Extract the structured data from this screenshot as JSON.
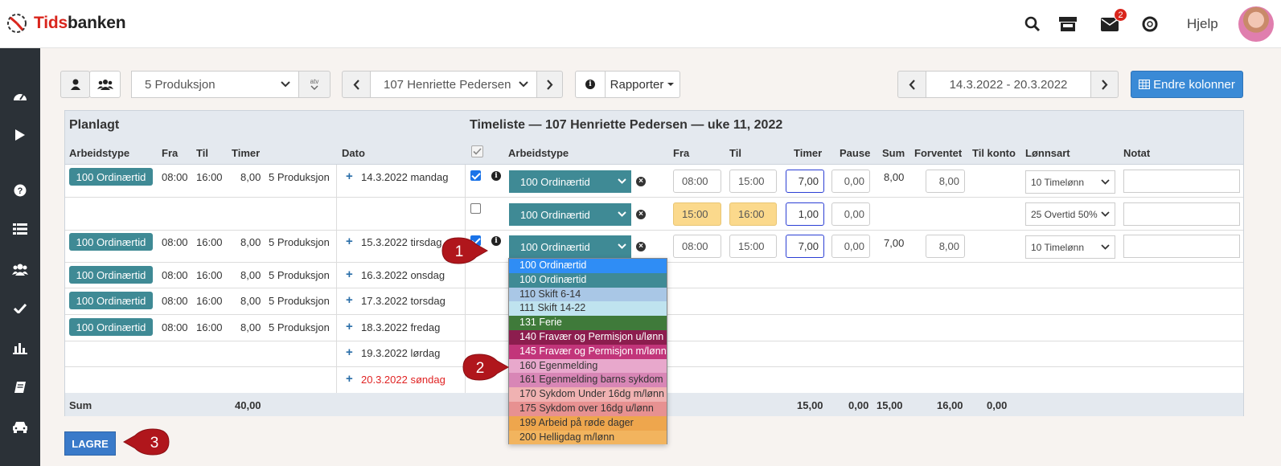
{
  "header": {
    "logo_prefix": "Tids",
    "logo_suffix": "banken",
    "mail_badge": "2",
    "help_label": "Hjelp"
  },
  "toolbar": {
    "department": "5 Produksjon",
    "atv_label": "atv",
    "employee": "107 Henriette Pedersen",
    "reports_label": "Rapporter",
    "date_range": "14.3.2022 - 20.3.2022",
    "change_columns_label": "Endre kolonner"
  },
  "panel": {
    "planned_title": "Planlagt",
    "timesheet_title": "Timeliste — 107 Henriette Pedersen — uke 11, 2022",
    "headers": {
      "arbeidstype": "Arbeidstype",
      "fra": "Fra",
      "til": "Til",
      "timer": "Timer",
      "dato": "Dato",
      "arbeidstype2": "Arbeidstype",
      "fra2": "Fra",
      "til2": "Til",
      "timer2": "Timer",
      "pause": "Pause",
      "sum": "Sum",
      "forventet": "Forventet",
      "til_konto": "Til konto",
      "lonnsart": "Lønnsart",
      "notat": "Notat"
    },
    "planned_rows": [
      {
        "type": "100 Ordinærtid",
        "fra": "08:00",
        "til": "16:00",
        "timer": "8,00",
        "dept": "5 Produksjon"
      },
      {
        "type": "100 Ordinærtid",
        "fra": "08:00",
        "til": "16:00",
        "timer": "8,00",
        "dept": "5 Produksjon"
      },
      {
        "type": "100 Ordinærtid",
        "fra": "08:00",
        "til": "16:00",
        "timer": "8,00",
        "dept": "5 Produksjon"
      },
      {
        "type": "100 Ordinærtid",
        "fra": "08:00",
        "til": "16:00",
        "timer": "8,00",
        "dept": "5 Produksjon"
      },
      {
        "type": "100 Ordinærtid",
        "fra": "08:00",
        "til": "16:00",
        "timer": "8,00",
        "dept": "5 Produksjon"
      }
    ],
    "dates": [
      "14.3.2022 mandag",
      "15.3.2022 tirsdag",
      "16.3.2022 onsdag",
      "17.3.2022 torsdag",
      "18.3.2022 fredag",
      "19.3.2022 lørdag",
      "20.3.2022 søndag"
    ],
    "entries": [
      {
        "type": "100 Ordinærtid",
        "fra": "08:00",
        "til": "15:00",
        "timer": "7,00",
        "pause": "0,00",
        "sum": "8,00",
        "forventet": "8,00",
        "lonnsart": "10 Timelønn"
      },
      {
        "type": "100 Ordinærtid",
        "fra": "15:00",
        "til": "16:00",
        "timer": "1,00",
        "pause": "0,00",
        "lonnsart": "25 Overtid 50%"
      },
      {
        "type": "100 Ordinærtid",
        "fra": "08:00",
        "til": "15:00",
        "timer": "7,00",
        "pause": "0,00",
        "sum": "7,00",
        "forventet": "8,00",
        "lonnsart": "10 Timelønn"
      }
    ],
    "sum_row": {
      "label": "Sum",
      "planned_timer": "40,00",
      "timer": "15,00",
      "pause": "0,00",
      "sum": "15,00",
      "forventet": "16,00",
      "til_konto": "0,00"
    }
  },
  "dropdown_options": [
    {
      "label": "100 Ordinærtid",
      "bg": "#2f8df5",
      "fg": "#ffffff"
    },
    {
      "label": "100 Ordinærtid",
      "bg": "#3f8a95",
      "fg": "#ffffff"
    },
    {
      "label": "110 Skift 6-14",
      "bg": "#a9c7e6",
      "fg": "#333333"
    },
    {
      "label": "111 Skift 14-22",
      "bg": "#bfe3ef",
      "fg": "#333333"
    },
    {
      "label": "131 Ferie",
      "bg": "#3f7a3a",
      "fg": "#ffffff"
    },
    {
      "label": "140 Fravær og Permisjon u/lønn",
      "bg": "#8c1d4e",
      "fg": "#ffffff"
    },
    {
      "label": "145 Fravær og Permisjon m/lønn",
      "bg": "#c2357a",
      "fg": "#ffffff"
    },
    {
      "label": "160 Egenmelding",
      "bg": "#e8a8cc",
      "fg": "#333333"
    },
    {
      "label": "161 Egenmelding barns sykdom",
      "bg": "#d886b6",
      "fg": "#333333"
    },
    {
      "label": "170 Sykdom Under 16dg m/lønn",
      "bg": "#f0b2b2",
      "fg": "#333333"
    },
    {
      "label": "175 Sykdom over 16dg u/lønn",
      "bg": "#e79191",
      "fg": "#333333"
    },
    {
      "label": "199 Arbeid på røde dager",
      "bg": "#eea64d",
      "fg": "#333333"
    },
    {
      "label": "200 Helligdag m/lønn",
      "bg": "#f2b45e",
      "fg": "#333333"
    }
  ],
  "callouts": [
    "1",
    "2",
    "3"
  ],
  "save_label": "LAGRE"
}
